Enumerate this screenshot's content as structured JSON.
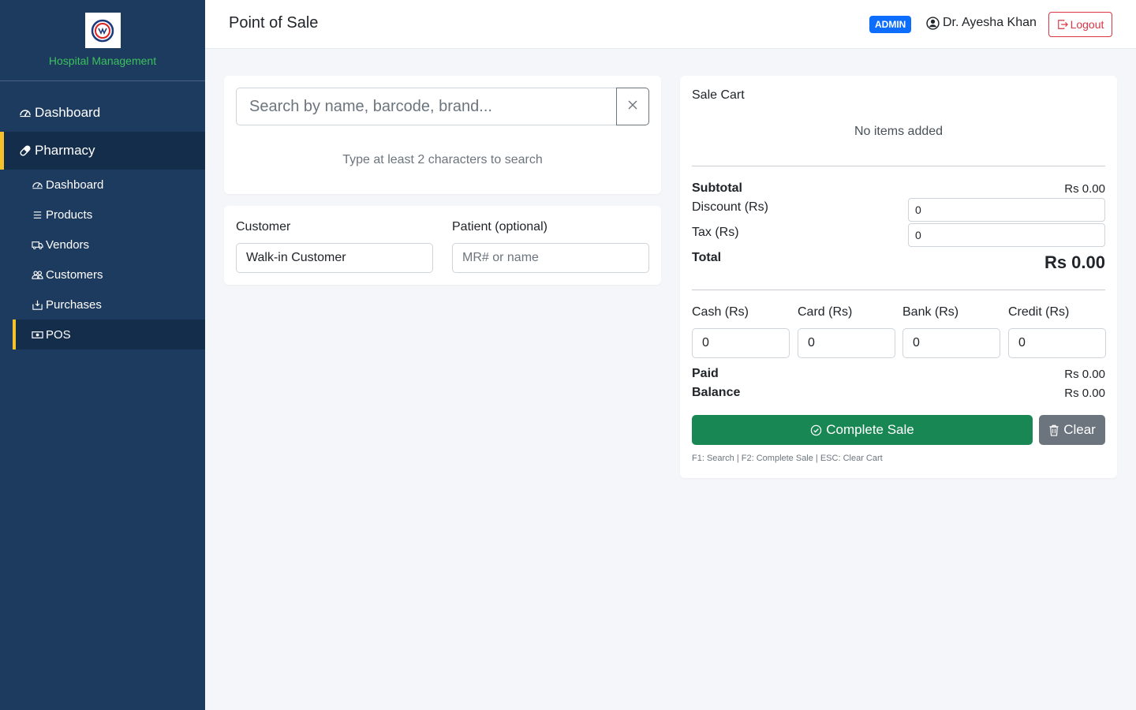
{
  "sidebar": {
    "brand_name": "Hospital Management",
    "nav": [
      {
        "label": "Dashboard",
        "icon": "speedometer-icon"
      },
      {
        "label": "Pharmacy",
        "icon": "capsule-icon"
      }
    ],
    "sub_items": [
      {
        "label": "Dashboard",
        "icon": "speedometer-icon"
      },
      {
        "label": "Products",
        "icon": "list-icon"
      },
      {
        "label": "Vendors",
        "icon": "truck-icon"
      },
      {
        "label": "Customers",
        "icon": "people-icon"
      },
      {
        "label": "Purchases",
        "icon": "box-arrow-icon"
      },
      {
        "label": "POS",
        "icon": "cash-icon"
      }
    ],
    "accent": "#f6c12a",
    "brand_color": "#3cc15c",
    "bg": "#1d3a5f"
  },
  "header": {
    "title": "Point of Sale",
    "role_badge": "ADMIN",
    "user_name": "Dr. Ayesha Khan",
    "logout_label": "Logout"
  },
  "search": {
    "placeholder": "Search by name, barcode, brand...",
    "hint": "Type at least 2 characters to search"
  },
  "customer": {
    "customer_label": "Customer",
    "customer_value": "Walk-in Customer",
    "patient_label": "Patient (optional)",
    "patient_placeholder": "MR# or name"
  },
  "cart": {
    "title": "Sale Cart",
    "empty_text": "No items added",
    "subtotal_label": "Subtotal",
    "subtotal_value": "Rs 0.00",
    "discount_label": "Discount (Rs)",
    "discount_value": "0",
    "tax_label": "Tax (Rs)",
    "tax_value": "0",
    "total_label": "Total",
    "total_value": "Rs 0.00",
    "payments": [
      {
        "label": "Cash (Rs)",
        "value": "0"
      },
      {
        "label": "Card (Rs)",
        "value": "0"
      },
      {
        "label": "Bank (Rs)",
        "value": "0"
      },
      {
        "label": "Credit (Rs)",
        "value": "0"
      }
    ],
    "paid_label": "Paid",
    "paid_value": "Rs 0.00",
    "balance_label": "Balance",
    "balance_value": "Rs 0.00",
    "complete_label": "Complete Sale",
    "clear_label": "Clear",
    "shortcuts": "F1: Search | F2: Complete Sale | ESC: Clear Cart",
    "complete_color": "#198754",
    "clear_color": "#6c757d"
  }
}
